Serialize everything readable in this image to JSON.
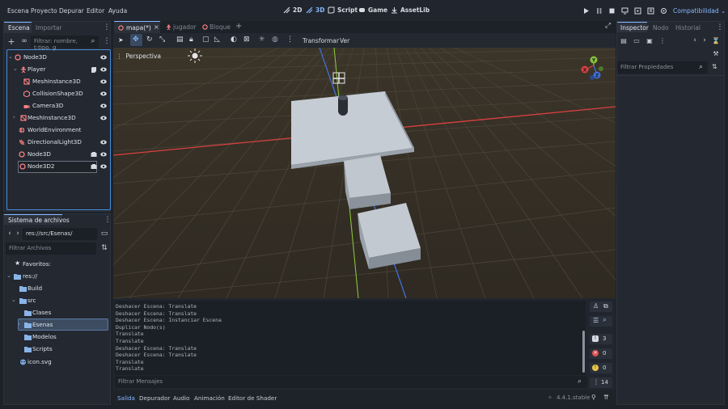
{
  "menu": [
    "Escena",
    "Proyecto",
    "Depurar",
    "Editor",
    "Ayuda"
  ],
  "modes": [
    {
      "label": "2D",
      "active": false
    },
    {
      "label": "3D",
      "active": true
    },
    {
      "label": "Script",
      "active": false
    },
    {
      "label": "Game",
      "active": false
    },
    {
      "label": "AssetLib",
      "active": false
    }
  ],
  "renderer": "Compatibilidad",
  "scene_panel": {
    "tabs": [
      "Escena",
      "Importar"
    ],
    "filter_placeholder": "Filtrar: nombre, t:tipo, g",
    "nodes": [
      {
        "label": "Node3D",
        "icon": "node3d-icon"
      },
      {
        "label": "Player",
        "icon": "character-body-icon"
      },
      {
        "label": "MeshInstance3D",
        "icon": "mesh-instance-icon"
      },
      {
        "label": "CollisionShape3D",
        "icon": "collision-shape-icon"
      },
      {
        "label": "Camera3D",
        "icon": "camera-icon"
      },
      {
        "label": "MeshInstance3D",
        "icon": "mesh-instance-icon"
      },
      {
        "label": "WorldEnvironment",
        "icon": "world-environment-icon"
      },
      {
        "label": "DirectionalLight3D",
        "icon": "directional-light-icon"
      },
      {
        "label": "Node3D",
        "icon": "node3d-icon"
      },
      {
        "label": "Node3D2",
        "icon": "node3d-icon"
      }
    ]
  },
  "filesystem": {
    "title": "Sistema de archivos",
    "path": "res://src/Esenas/",
    "filter_placeholder": "Filtrar Archivos",
    "items": [
      {
        "label": "Favoritos:",
        "icon": "star-icon"
      },
      {
        "label": "res://",
        "icon": "folder-icon"
      },
      {
        "label": "Build",
        "icon": "folder-icon"
      },
      {
        "label": "src",
        "icon": "folder-icon"
      },
      {
        "label": "Clases",
        "icon": "folder-icon"
      },
      {
        "label": "Esenas",
        "icon": "folder-icon"
      },
      {
        "label": "Modelos",
        "icon": "folder-icon"
      },
      {
        "label": "Scripts",
        "icon": "folder-icon"
      },
      {
        "label": "icon.svg",
        "icon": "image-file-icon"
      }
    ]
  },
  "editor_tabs": [
    {
      "label": "mapa(*)",
      "active": true
    },
    {
      "label": "jugador",
      "active": false
    },
    {
      "label": "Bloque",
      "active": false
    }
  ],
  "toolbar": {
    "transform_label": "Transformar",
    "view_label": "Ver"
  },
  "viewport": {
    "perspective_label": "Perspectiva",
    "gizmo_axes": [
      "X",
      "Y",
      "Z"
    ]
  },
  "output": {
    "log": [
      "Deshacer Escena: Translate",
      "Deshacer Escena: Translate",
      "Deshacer Escena: Instanciar Escena",
      "Duplicar Nodo(s)",
      "Translate",
      "Translate",
      "Deshacer Escena: Translate",
      "Deshacer Escena: Translate",
      "Translate",
      "Translate"
    ],
    "filter_placeholder": "Filtrar Mensajes",
    "counts": {
      "errors": "0",
      "warnings": "0",
      "messages": "14",
      "info": "3"
    },
    "tabs": [
      "Salida",
      "Depurador",
      "Audio",
      "Animación",
      "Editor de Shader"
    ],
    "version": "4.4.1.stable"
  },
  "inspector": {
    "tabs": [
      "Inspector",
      "Nodo",
      "Historial"
    ],
    "filter_placeholder": "Filtrar Propiedades"
  },
  "colors": {
    "accent": "#86b7ff",
    "x_axis": "#e04545",
    "y_axis": "#8bd13d",
    "z_axis": "#4a7fe0"
  }
}
